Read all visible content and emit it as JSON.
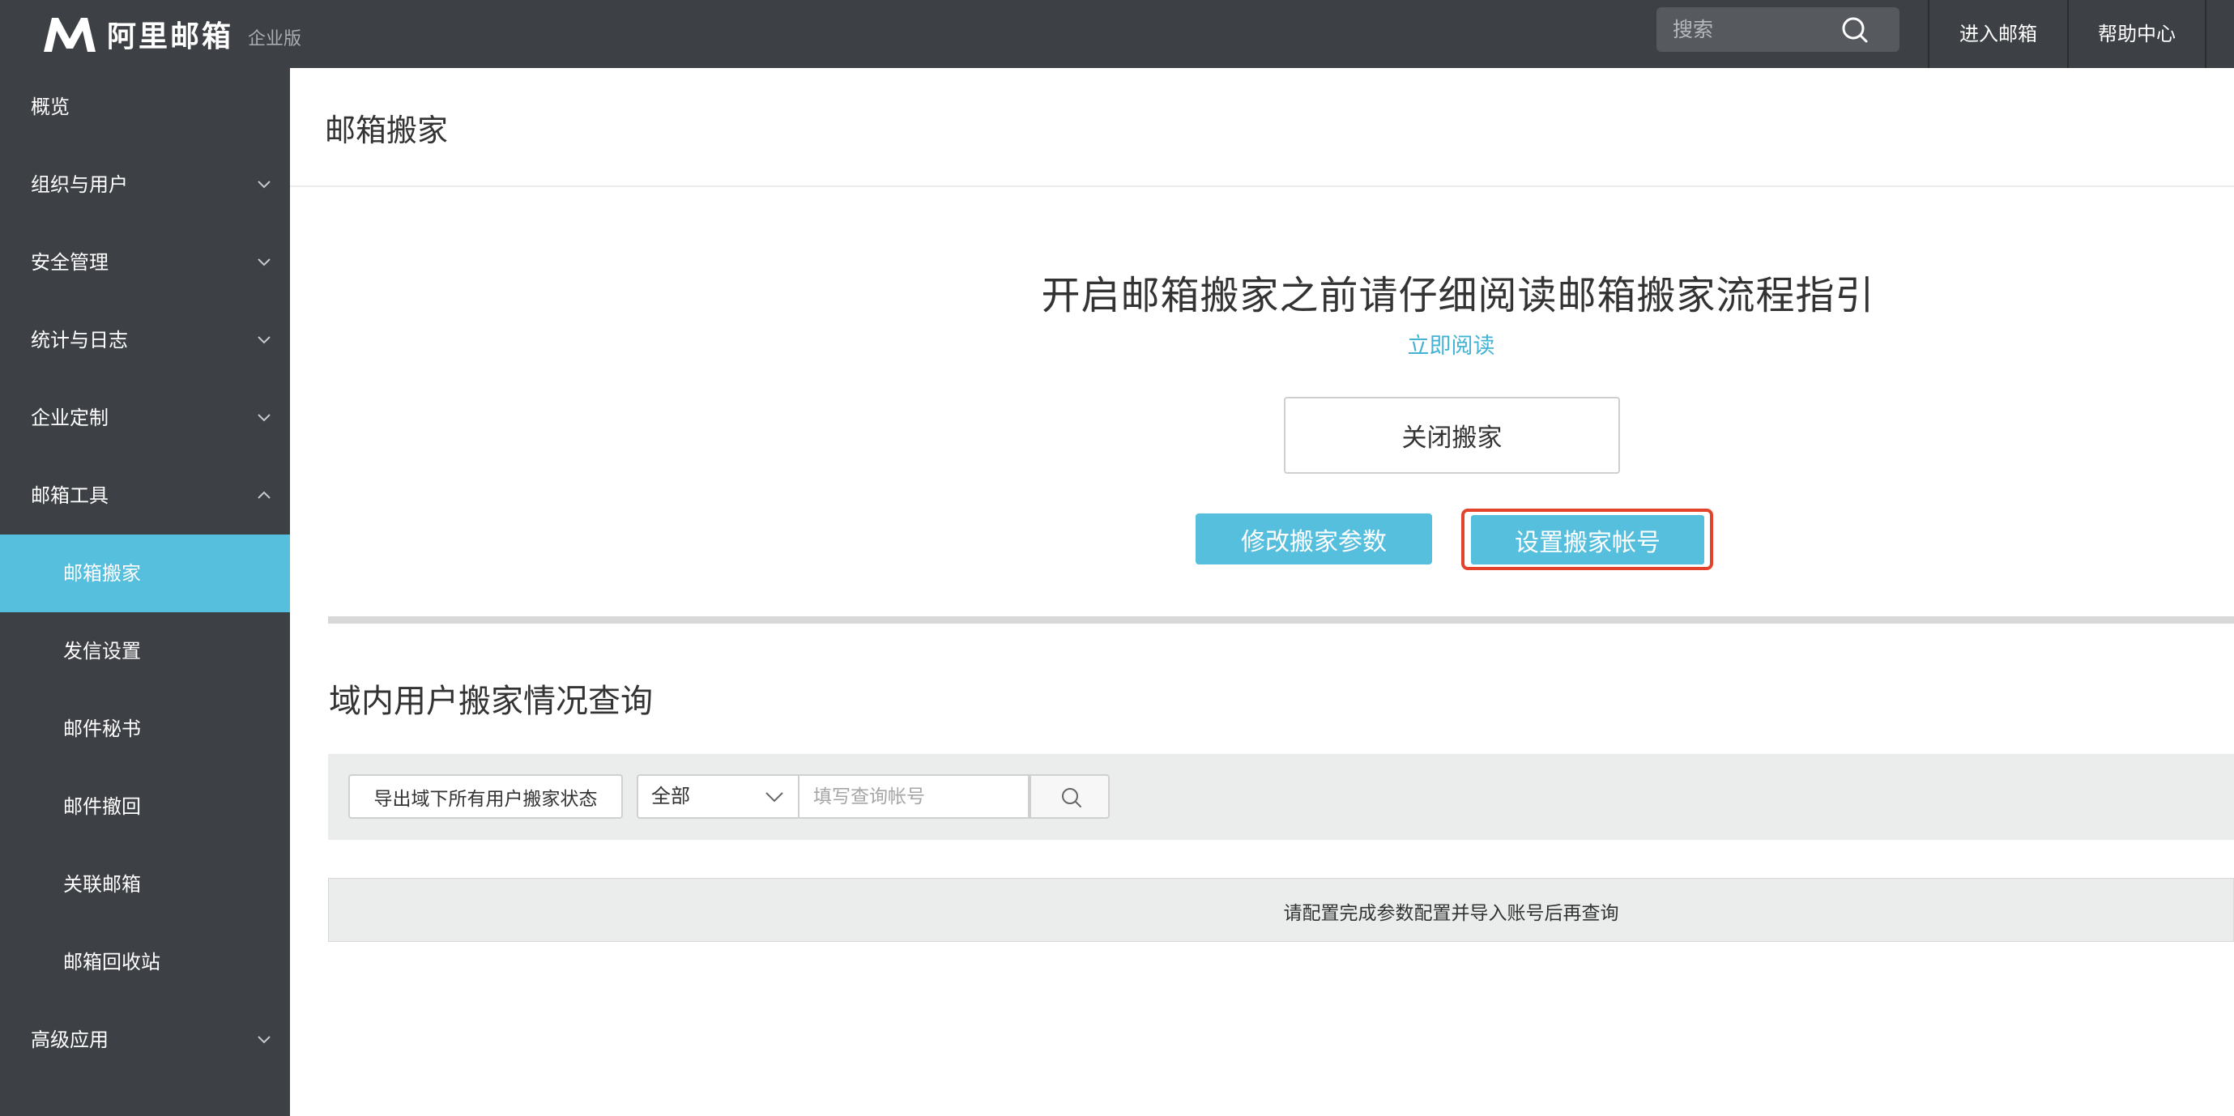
{
  "header": {
    "brand_name": "阿里邮箱",
    "brand_edition": "企业版",
    "search_placeholder": "搜索",
    "enter_mailbox": "进入邮箱",
    "help_center": "帮助中心"
  },
  "sidebar": {
    "items": [
      {
        "label": "概览",
        "expandable": false
      },
      {
        "label": "组织与用户",
        "expandable": true
      },
      {
        "label": "安全管理",
        "expandable": true
      },
      {
        "label": "统计与日志",
        "expandable": true
      },
      {
        "label": "企业定制",
        "expandable": true
      },
      {
        "label": "邮箱工具",
        "expandable": true,
        "expanded": true
      },
      {
        "label": "邮箱搬家",
        "sub": true,
        "active": true
      },
      {
        "label": "发信设置",
        "sub": true
      },
      {
        "label": "邮件秘书",
        "sub": true
      },
      {
        "label": "邮件撤回",
        "sub": true
      },
      {
        "label": "关联邮箱",
        "sub": true
      },
      {
        "label": "邮箱回收站",
        "sub": true
      },
      {
        "label": "高级应用",
        "expandable": true
      }
    ]
  },
  "main": {
    "page_title": "邮箱搬家",
    "guide_title": "开启邮箱搬家之前请仔细阅读邮箱搬家流程指引",
    "read_now": "立即阅读",
    "close_migration": "关闭搬家",
    "modify_params": "修改搬家参数",
    "set_accounts": "设置搬家帐号",
    "section_title": "域内用户搬家情况查询",
    "export_button": "导出域下所有用户搬家状态",
    "filter_selected": "全部",
    "query_placeholder": "填写查询帐号",
    "empty_message": "请配置完成参数配置并导入账号后再查询"
  },
  "colors": {
    "sidebar_bg": "#3d4044",
    "accent": "#56bfdd",
    "link": "#42b3d4",
    "highlight_border": "#e2432a"
  }
}
